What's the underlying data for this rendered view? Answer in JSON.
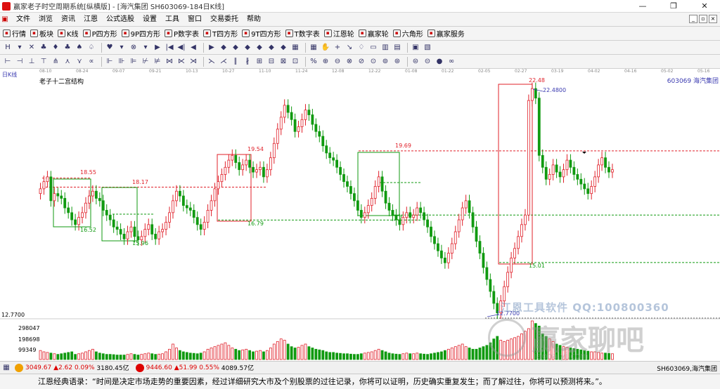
{
  "window": {
    "title": "赢家老子时空周期系统[纵横版] - [海汽集团  SH603069-184日K线]",
    "min": "—",
    "max": "❐",
    "close": "✕"
  },
  "menu": [
    "文件",
    "浏览",
    "资讯",
    "江恩",
    "公式选股",
    "设置",
    "工具",
    "窗口",
    "交易委托",
    "帮助"
  ],
  "toolbar2": [
    {
      "label": "行情",
      "icon": "grid-icon"
    },
    {
      "label": "板块",
      "icon": "blocks-icon"
    },
    {
      "label": "K线",
      "icon": "candle-icon"
    },
    {
      "label": "P四方形",
      "icon": "p-square-icon"
    },
    {
      "label": "9P四方形",
      "icon": "9p-square-icon"
    },
    {
      "label": "P数字表",
      "icon": "p-table-icon"
    },
    {
      "label": "T四方形",
      "icon": "t-square-icon"
    },
    {
      "label": "9T四方形",
      "icon": "9t-square-icon"
    },
    {
      "label": "T数字表",
      "icon": "t-table-icon"
    },
    {
      "label": "江恩轮",
      "icon": "wheel-icon"
    },
    {
      "label": "赢家轮",
      "icon": "wheel2-icon"
    },
    {
      "label": "六角形",
      "icon": "hexagon-icon"
    },
    {
      "label": "赢家服务",
      "icon": "dollar-icon"
    }
  ],
  "axis_dates": [
    "08-10",
    "08-24",
    "09-07",
    "09-21",
    "10-13",
    "10-27",
    "11-10",
    "11-24",
    "12-08",
    "12-22",
    "01-08",
    "01-22",
    "02-05",
    "02-27",
    "03-19",
    "04-02",
    "04-16",
    "05-02",
    "05-16"
  ],
  "rk_label": "日K线",
  "chart_title": "老子十二宫结构",
  "stock_label": "603069  海汽集团",
  "price_labels": {
    "p1855": "18.55",
    "p1817": "18.17",
    "p1652": "16.52",
    "p1596": "15.96",
    "p1954": "19.54",
    "p1679": "16.79",
    "p1969": "19.69",
    "p17": "17",
    "p2248": "22.48",
    "p224800": "22.4800",
    "p1501": "15.01",
    "p127700": "12.7700"
  },
  "left_axis": {
    "low_price": "12.7700",
    "vol1": "298047",
    "vol2": "198698",
    "vol3": "99349"
  },
  "watermarks": {
    "w1": "江恩工具软件  QQ:100800360",
    "w2": "赢家聊吧",
    "w2url": "iaoba.yj.com"
  },
  "status": {
    "s1": "3049.67",
    "s1c": "▲2.62",
    "s1p": "0.09%",
    "s1v": "3180.45亿",
    "s2": "9446.60",
    "s2c": "▲51.99",
    "s2p": "0.55%",
    "s2v": "4089.57亿",
    "right": "SH603069,海汽集团"
  },
  "quote": "江恩经典语录：“时间是决定市场走势的重要因素，经过详细研究大市及个别股票的过往记录，你将可以证明，历史确实重复发生；而了解过往，你将可以预测将来。”。",
  "colors": {
    "up": "#e0202a",
    "down": "#109a10",
    "box_green": "#109a10",
    "box_red": "#e0202a",
    "blue": "#3a3ab0"
  },
  "chart_data": {
    "type": "candlestick",
    "symbol": "603069",
    "period": "daily",
    "ylim": [
      12.77,
      22.48
    ],
    "levels": [
      {
        "label": "18.55",
        "value": 18.55
      },
      {
        "label": "18.17",
        "value": 18.17
      },
      {
        "label": "16.52",
        "value": 16.52
      },
      {
        "label": "15.96",
        "value": 15.96
      },
      {
        "label": "19.54",
        "value": 19.54
      },
      {
        "label": "16.79",
        "value": 16.79
      },
      {
        "label": "19.69",
        "value": 19.69
      },
      {
        "label": "17",
        "value": 17.0
      },
      {
        "label": "22.48",
        "value": 22.48
      },
      {
        "label": "15.01",
        "value": 15.01
      },
      {
        "label": "12.7700",
        "value": 12.77
      }
    ],
    "closes": [
      18.1,
      18.4,
      18.6,
      17.6,
      17.9,
      17.8,
      17.7,
      17.3,
      17.1,
      16.8,
      16.6,
      16.9,
      17.1,
      17.5,
      17.8,
      18.0,
      17.7,
      17.6,
      17.2,
      17.0,
      16.8,
      16.5,
      16.4,
      16.2,
      16.0,
      16.3,
      16.5,
      16.1,
      15.96,
      16.1,
      16.4,
      16.6,
      16.2,
      16.0,
      16.3,
      16.4,
      16.7,
      17.1,
      17.6,
      18.0,
      17.8,
      17.4,
      17.3,
      17.2,
      16.9,
      16.6,
      16.4,
      16.7,
      17.2,
      17.6,
      18.1,
      18.4,
      18.7,
      19.0,
      19.3,
      19.5,
      19.2,
      18.9,
      19.1,
      19.3,
      19.0,
      18.8,
      18.9,
      19.0,
      18.6,
      18.9,
      19.4,
      20.0,
      20.6,
      21.1,
      21.6,
      21.3,
      21.0,
      20.5,
      20.7,
      21.0,
      21.4,
      21.2,
      20.8,
      20.5,
      20.3,
      19.9,
      19.6,
      19.4,
      19.3,
      19.0,
      18.7,
      18.4,
      18.2,
      17.9,
      17.6,
      17.2,
      16.9,
      17.1,
      17.4,
      17.7,
      18.2,
      18.6,
      18.0,
      17.5,
      17.2,
      17.0,
      16.8,
      16.6,
      16.9,
      17.1,
      16.9,
      17.0,
      17.3,
      17.1,
      16.8,
      16.5,
      16.1,
      15.8,
      15.5,
      15.2,
      15.0,
      15.4,
      15.8,
      16.3,
      16.8,
      17.3,
      17.6,
      17.1,
      16.5,
      15.9,
      15.4,
      14.8,
      14.3,
      13.8,
      13.3,
      12.9,
      13.4,
      14.0,
      14.6,
      15.2,
      15.6,
      16.1,
      16.6,
      17.0,
      21.8,
      22.3,
      21.9,
      19.5,
      19.0,
      18.5,
      18.7,
      19.1,
      18.8,
      18.6,
      18.9,
      19.3,
      19.0,
      18.7,
      18.5,
      18.3,
      18.1,
      17.9,
      18.2,
      18.6,
      19.1,
      19.4,
      19.0,
      18.8,
      18.9
    ],
    "volumes": [
      70,
      60,
      55,
      50,
      45,
      40,
      45,
      50,
      55,
      60,
      40,
      45,
      50,
      60,
      70,
      80,
      60,
      50,
      45,
      40,
      40,
      38,
      35,
      35,
      35,
      40,
      45,
      40,
      35,
      40,
      45,
      50,
      45,
      40,
      42,
      45,
      60,
      80,
      120,
      90,
      70,
      60,
      55,
      50,
      48,
      45,
      50,
      60,
      80,
      90,
      100,
      110,
      120,
      130,
      110,
      90,
      80,
      70,
      75,
      80,
      70,
      60,
      65,
      70,
      60,
      70,
      90,
      120,
      140,
      160,
      150,
      120,
      100,
      90,
      95,
      110,
      120,
      100,
      90,
      80,
      75,
      70,
      60,
      55,
      55,
      50,
      48,
      45,
      45,
      42,
      40,
      40,
      45,
      50,
      55,
      60,
      70,
      80,
      70,
      60,
      50,
      45,
      42,
      40,
      45,
      50,
      45,
      45,
      50,
      45,
      42,
      40,
      45,
      50,
      55,
      60,
      70,
      80,
      90,
      100,
      110,
      120,
      100,
      90,
      80,
      80,
      90,
      100,
      110,
      130,
      160,
      180,
      150,
      140,
      150,
      160,
      170,
      180,
      200,
      220,
      240,
      300,
      280,
      260,
      200,
      180,
      160,
      140,
      120,
      110,
      100,
      95,
      90,
      85,
      80,
      75,
      70,
      65,
      60,
      60,
      55,
      50,
      50,
      48,
      45
    ]
  }
}
